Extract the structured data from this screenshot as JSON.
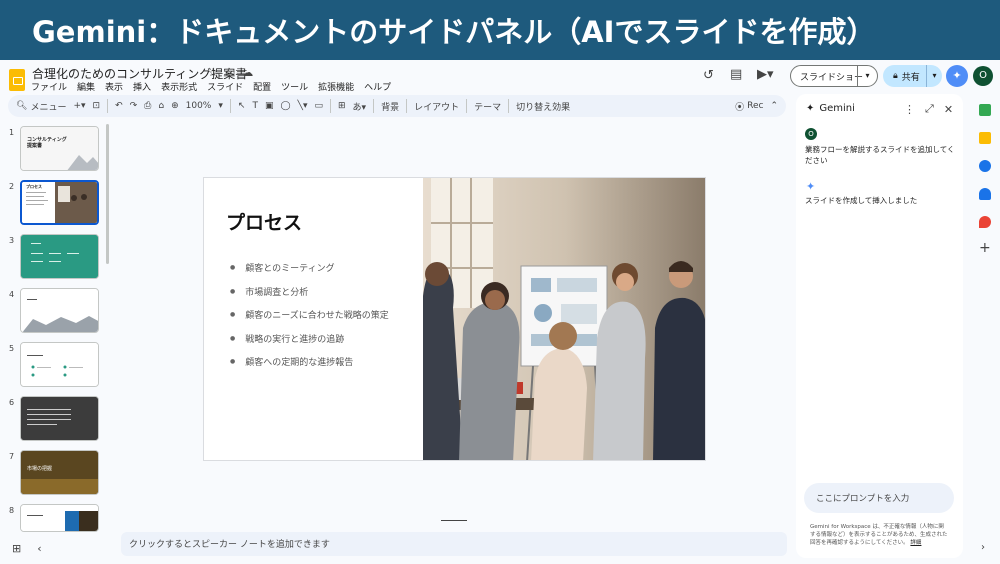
{
  "banner": {
    "text": "Gemini：ドキュメントのサイドパネル（AIでスライドを作成）"
  },
  "document": {
    "title": "合理化のためのコンサルティング提案書"
  },
  "menu": [
    "ファイル",
    "編集",
    "表示",
    "挿入",
    "表示形式",
    "スライド",
    "配置",
    "ツール",
    "拡張機能",
    "ヘルプ"
  ],
  "header": {
    "slideshow_label": "スライドショー",
    "share_label": "共有",
    "avatar_letter": "O"
  },
  "toolbar": {
    "menu_label": "メニュー",
    "zoom": "100%",
    "background": "背景",
    "layout": "レイアウト",
    "theme": "テーマ",
    "transition": "切り替え効果",
    "rec": "Rec"
  },
  "filmstrip": [
    {
      "num": "1",
      "title": "コンサルティング提案書"
    },
    {
      "num": "2",
      "title": "プロセス"
    },
    {
      "num": "3",
      "title": ""
    },
    {
      "num": "4",
      "title": ""
    },
    {
      "num": "5",
      "title": ""
    },
    {
      "num": "6",
      "title": ""
    },
    {
      "num": "7",
      "title": "市場の把握"
    },
    {
      "num": "8",
      "title": ""
    }
  ],
  "slide": {
    "title": "プロセス",
    "bullets": [
      "顧客とのミーティング",
      "市場調査と分析",
      "顧客のニーズに合わせた戦略の策定",
      "戦略の実行と進捗の追跡",
      "顧客への定期的な進捗報告"
    ]
  },
  "notes": {
    "placeholder": "クリックするとスピーカー ノートを追加できます"
  },
  "gemini": {
    "title": "Gemini",
    "user_letter": "O",
    "user_message": "業務フローを解説するスライドを追加してください",
    "ai_message": "スライドを作成して挿入しました",
    "prompt_placeholder": "ここにプロンプトを入力",
    "disclaimer": "Gemini for Workspace は、不正確な情報（人物に関する情報など）を表示することがあるため、生成された回答を再確認するようにしてください。",
    "disclaimer_link": "詳細"
  },
  "colors": {
    "banner": "#1e5a7d",
    "accent": "#0b57d0",
    "share_bg": "#c2e7ff"
  }
}
